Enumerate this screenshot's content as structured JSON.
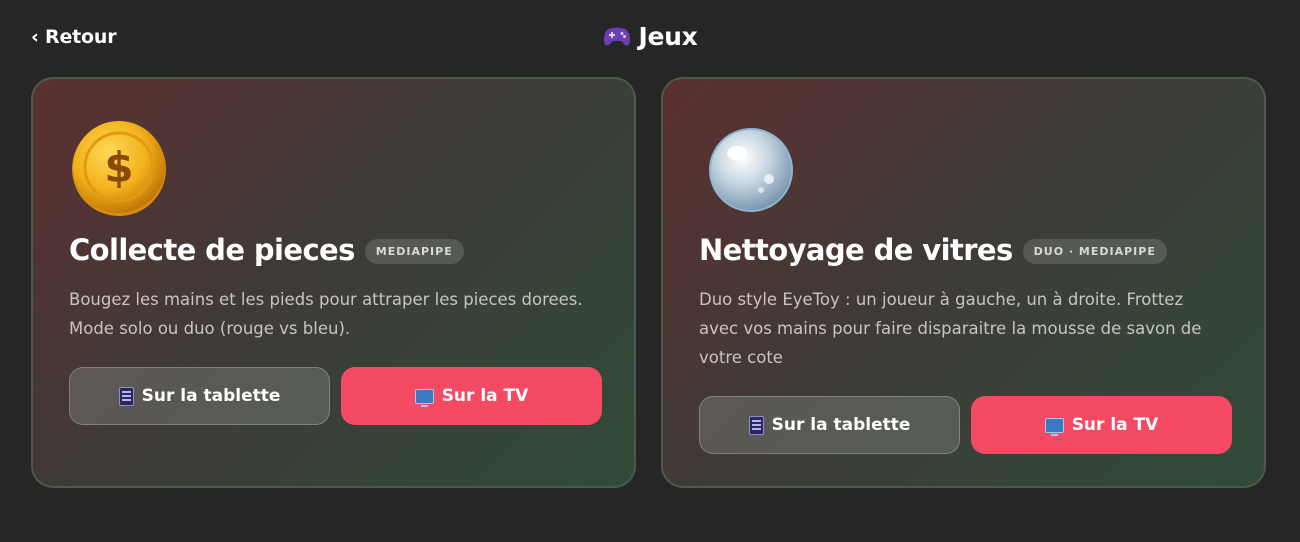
{
  "header": {
    "back_label": "‹ Retour",
    "title": "Jeux",
    "title_icon": "gamepad-icon"
  },
  "cards": [
    {
      "icon": "coin-icon",
      "title": "Collecte de pieces",
      "badge": "MEDIAPIPE",
      "description": "Bougez les mains et les pieds pour attraper les pieces dorees. Mode solo ou duo (rouge vs bleu).",
      "tablet_label": "Sur la tablette",
      "tv_label": "Sur la TV"
    },
    {
      "icon": "bubble-icon",
      "title": "Nettoyage de vitres",
      "badge": "DUO · MEDIAPIPE",
      "description": "Duo style EyeToy : un joueur à gauche, un à droite. Frottez avec vos mains pour faire disparaitre la mousse de savon de votre cote",
      "tablet_label": "Sur la tablette",
      "tv_label": "Sur la TV"
    }
  ],
  "colors": {
    "background": "#262626",
    "tv_button": "#f44a63",
    "coin_gold": "#f2b21c",
    "bubble_blue": "#9fc0d8"
  }
}
